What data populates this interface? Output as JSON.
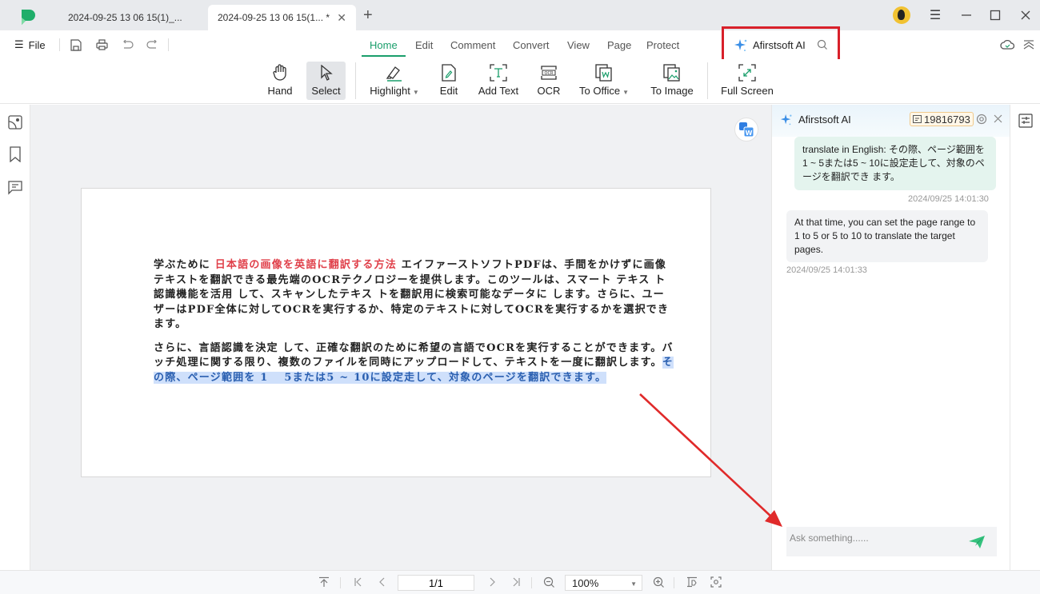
{
  "tabs": [
    {
      "label": "2024-09-25 13 06 15(1)_...",
      "active": false
    },
    {
      "label": "2024-09-25 13 06 15(1... *",
      "active": true
    }
  ],
  "menu": {
    "file_label": "File",
    "tabs": [
      "Home",
      "Edit",
      "Comment",
      "Convert",
      "View",
      "Page",
      "Protect"
    ],
    "active_tab": "Home",
    "ai_button_label": "Afirstsoft AI"
  },
  "ribbon": {
    "tools": [
      {
        "label": "Hand",
        "icon": "hand-icon"
      },
      {
        "label": "Select",
        "icon": "cursor-icon",
        "selected": true
      },
      {
        "label": "Highlight",
        "icon": "highlighter-icon",
        "dropdown": true
      },
      {
        "label": "Edit",
        "icon": "edit-icon"
      },
      {
        "label": "Add Text",
        "icon": "add-text-icon"
      },
      {
        "label": "OCR",
        "icon": "ocr-icon"
      },
      {
        "label": "To Office",
        "icon": "to-office-icon",
        "dropdown": true
      },
      {
        "label": "To Image",
        "icon": "to-image-icon"
      },
      {
        "label": "Full Screen",
        "icon": "fullscreen-icon"
      }
    ]
  },
  "document": {
    "para1_pre": "学ぶために ",
    "para1_red": "日本語の画像を英語に翻訳する方法",
    "para1_post": " エイファーストソフトPDFは、手間をかけずに画像テキストを翻訳できる最先端のOCRテクノロジーを提供します。このツールは、スマート テキス ト認識機能を活用 して、スキャンしたテキス トを翻訳用に検索可能なデータに します。さらに、ユーザーはPDF全体に対してOCRを実行するか、特定のテキストに対してOCRを実行するかを選択できます。",
    "para2_pre": "さらに、言語認識を決定 して、正確な翻訳のために希望の言語でOCRを実行することができます。バッチ処理に関する限り、複数のファイルを同時にアップロードして、テキストを一度に翻訳します。",
    "para2_highlight": "その際、ページ範囲を 1　 5または5 ~ 10に設定走して、対象のページを翻訳できます。"
  },
  "ai_panel": {
    "title": "Afirstsoft AI",
    "credits": "19816793",
    "messages": [
      {
        "role": "user",
        "text": "translate in English: その際、ページ範囲を 1 ~ 5または5 ~ 10に設定走して、対象のページを翻訳でき ます。",
        "time": "2024/09/25 14:01:30"
      },
      {
        "role": "assistant",
        "text": "At that time, you can set the page range to 1 to 5 or 5 to 10 to translate the target pages.",
        "time": "2024/09/25 14:01:33"
      }
    ],
    "input_placeholder": "Ask something......"
  },
  "statusbar": {
    "page_value": "1/1",
    "zoom_value": "100%"
  },
  "colors": {
    "accent": "#1a9e6b",
    "annotation_red": "#d8202a",
    "highlight": "#cfe0fb"
  }
}
